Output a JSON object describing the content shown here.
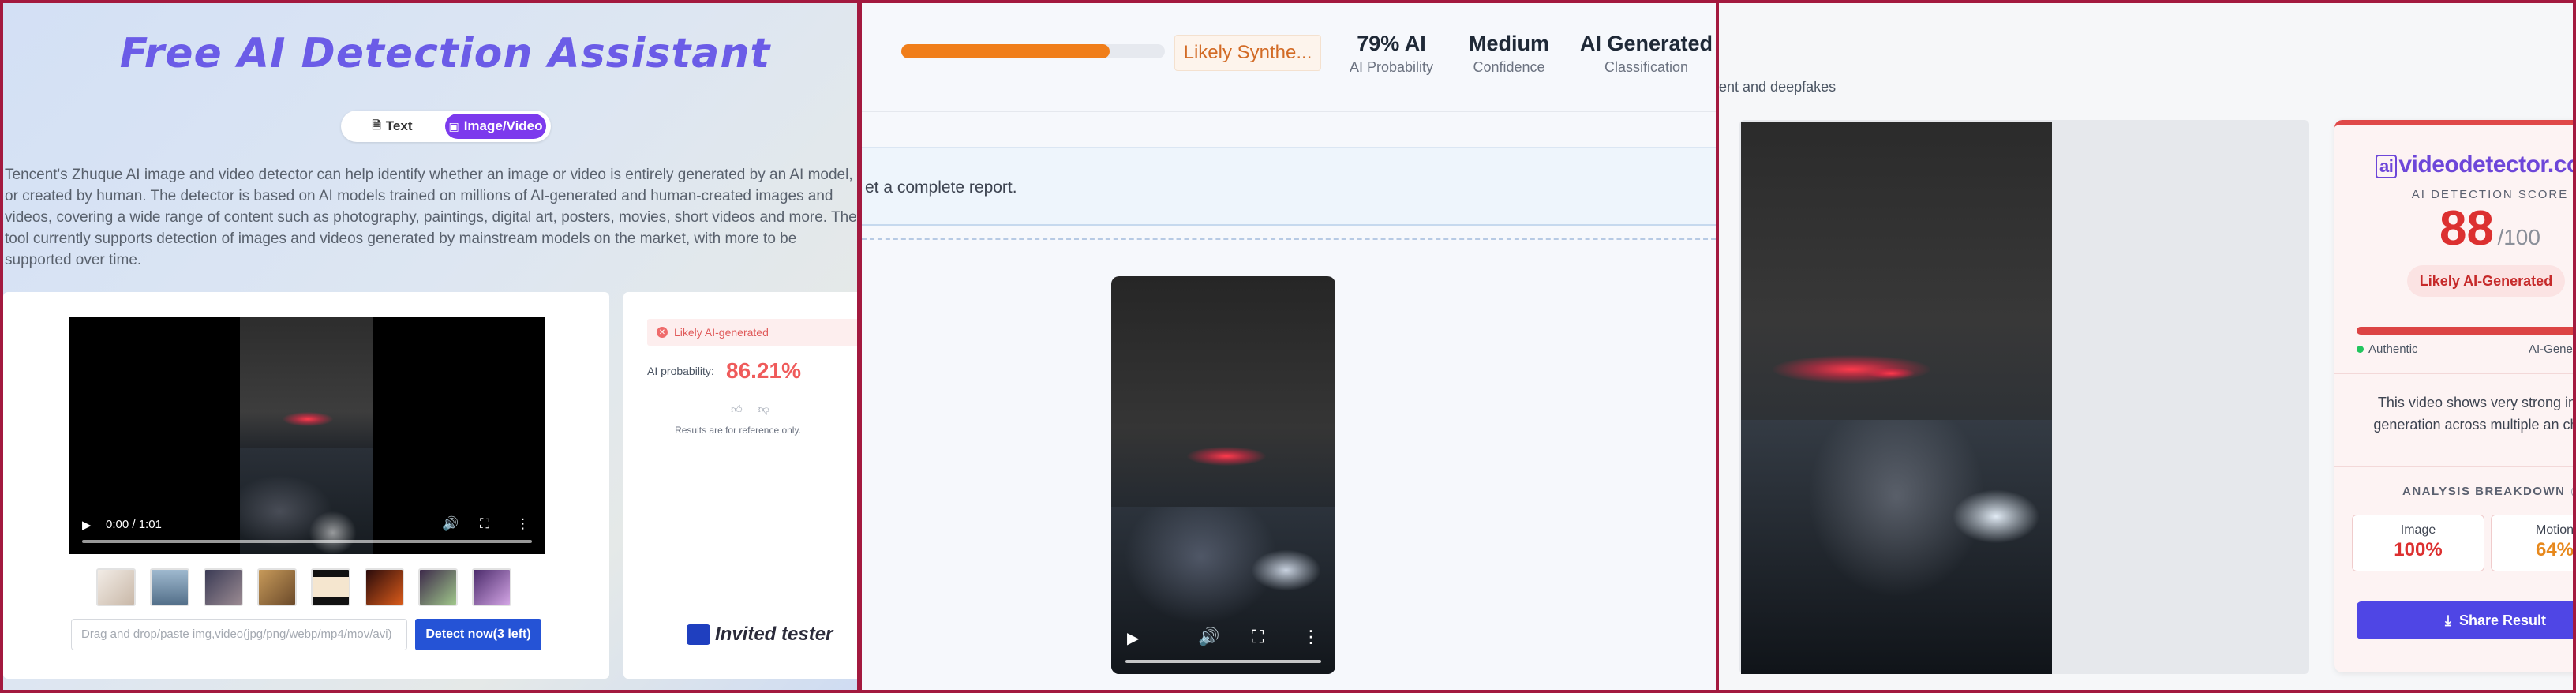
{
  "panel1": {
    "title": "Free AI Detection Assistant",
    "tabs": {
      "text": "Text",
      "image_video": "Image/Video"
    },
    "description": "Tencent's Zhuque AI image and video detector can help identify whether an image or video is entirely generated by an AI model, or created by human. The detector is based on AI models trained on millions of AI-generated and human-created images and videos, covering a wide range of content such as photography, paintings, digital art, posters, movies, short videos and more. The tool currently supports detection of images and videos generated by mainstream models on the market, with more to be supported over time.",
    "video": {
      "time": "0:00 / 1:01"
    },
    "upload": {
      "placeholder": "Drag and drop/paste img,video(jpg/png/webp/mp4/mov/avi)",
      "detect_label": "Detect now(3 left)"
    },
    "result": {
      "badge": "Likely AI-generated",
      "prob_label": "AI probability:",
      "prob_value": "86.21%",
      "note": "Results are for reference only.",
      "tester": "Invited tester"
    }
  },
  "panel2": {
    "progress": 0.79,
    "verdict_pill": "Likely Synthe...",
    "stats": [
      {
        "value": "79% AI",
        "label": "AI Probability"
      },
      {
        "value": "Medium",
        "label": "Confidence"
      },
      {
        "value": "AI Generated",
        "label": "Classification"
      }
    ],
    "banner_text": "et a complete report."
  },
  "panel3": {
    "subtitle": "ent and deepfakes",
    "brand": {
      "bracket": "ai",
      "name": "videodetector.co"
    },
    "score_label": "AI DETECTION SCORE",
    "score_value": "88",
    "score_max": "/100",
    "score_fraction": 0.88,
    "verdict": "Likely AI-Generated",
    "scale_left": "Authentic",
    "scale_right": "AI-Gene",
    "explanation": "This video shows very strong indi of AI generation across multiple an channels.",
    "breakdown_title": "ANALYSIS BREAKDOWN",
    "metrics": [
      {
        "label": "Image",
        "value": "100%"
      },
      {
        "label": "Motion",
        "value": "64%"
      }
    ],
    "share_label": "Share Result"
  },
  "colors": {
    "accent_purple": "#7c3aed",
    "detect_blue": "#2553d6",
    "warn_orange": "#f07e1a",
    "score_red": "#dc3030",
    "share_indigo": "#4f46e5"
  }
}
